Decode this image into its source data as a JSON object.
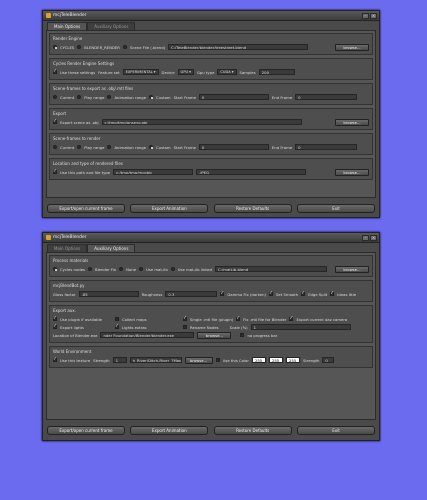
{
  "w1": {
    "title": "mcjTeleBlender",
    "tabs": [
      "Main Options",
      "Auxiliary Options"
    ],
    "render_engine": {
      "title": "Render Engine",
      "options": [
        "CYCLES",
        "BLENDER_RENDER",
        "Scene File (.blend)"
      ],
      "path": "C:/TeleBlender/blender/treestreet.blend",
      "browse": "browse..."
    },
    "cycles": {
      "title": "Cycles Render Engine Settings",
      "use_label": "Use these settings",
      "feature_label": "Feature set",
      "feature_val": "EXPERIMENTAL",
      "device_label": "Device",
      "device_val": "GPU",
      "gputype_label": "Gpu type",
      "gputype_val": "CUDA",
      "samples_label": "Samples",
      "samples_val": "200"
    },
    "export_frames": {
      "title": "Scene-frames to export as .obj/.mtl files",
      "opts": [
        "Current",
        "Play range",
        "Animation range",
        "Custom"
      ],
      "start_label": "Start Frame",
      "start_val": "0",
      "end_label": "End Frame",
      "end_val": "0"
    },
    "export": {
      "title": "Export",
      "label": "Export scene as .obj",
      "path": "c:/tmp/tmp/anseyo.obj",
      "browse": "browse..."
    },
    "render_frames": {
      "title": "Scene-frames to render",
      "opts": [
        "Current",
        "Play range",
        "Animation range",
        "Custom"
      ],
      "start_label": "Start Frame",
      "start_val": "0",
      "end_label": "End Frame",
      "end_val": "0"
    },
    "location": {
      "title": "Location and type of rendered files",
      "label": "Use this path and file type",
      "path": "c:/tmp/tmp/mcobjc",
      "type": ".JPEG",
      "browse": "browse..."
    },
    "buttons": [
      "Export/open current frame",
      "Export Animation",
      "Restore Defaults",
      "Exit"
    ]
  },
  "w2": {
    "title": "mcjTeleBlender",
    "tabs": [
      "Main Options",
      "Auxiliary Options"
    ],
    "materials": {
      "title": "Process materials",
      "opts": [
        "Cycles nodes",
        "Blender Fix",
        "None",
        "Use mat-lib",
        "Use mat-lib linked"
      ],
      "path": "C:/matLib.blend",
      "browse": "browse..."
    },
    "script": {
      "title": "mcjBlendBot.py",
      "gloss_label": "Gloss factor",
      "gloss_val": ".85",
      "rough_label": "Roughness",
      "rough_val": "0.3",
      "checks": [
        "Gamma Fix (darken)",
        "Set Smooth",
        "Edge Split",
        "Ideas Ittle"
      ]
    },
    "export_aux": {
      "title": "Export aux.",
      "row1": [
        "Use plugin if available",
        "Collect maps",
        "Single .mtl file (plugin)",
        "Fix .mtl file for Blender",
        "Export current daz camera"
      ],
      "row2": [
        "Export lights",
        "Lights extras",
        "Rename Nodes"
      ],
      "scale_label": "Scale (%)",
      "scale_val": "1",
      "loc_label": "Location of Blender.exe",
      "loc_val": "nder Foundation/Blender/blender.exe",
      "browse": "browse...",
      "noprog": "no progress bar"
    },
    "world": {
      "title": "World Environment",
      "tex_label": "Use this texture",
      "strength_label": "Strength",
      "strength_val": "1",
      "tex_path": "h_River/Ditch-River_7Map.jpg",
      "browse": "browse...",
      "color_label": "Use this Color",
      "r": "255",
      "g": "255",
      "b": "255",
      "strength2_val": "0"
    },
    "buttons": [
      "Export/open current frame",
      "Export Animation",
      "Restore Defaults",
      "Exit"
    ]
  }
}
